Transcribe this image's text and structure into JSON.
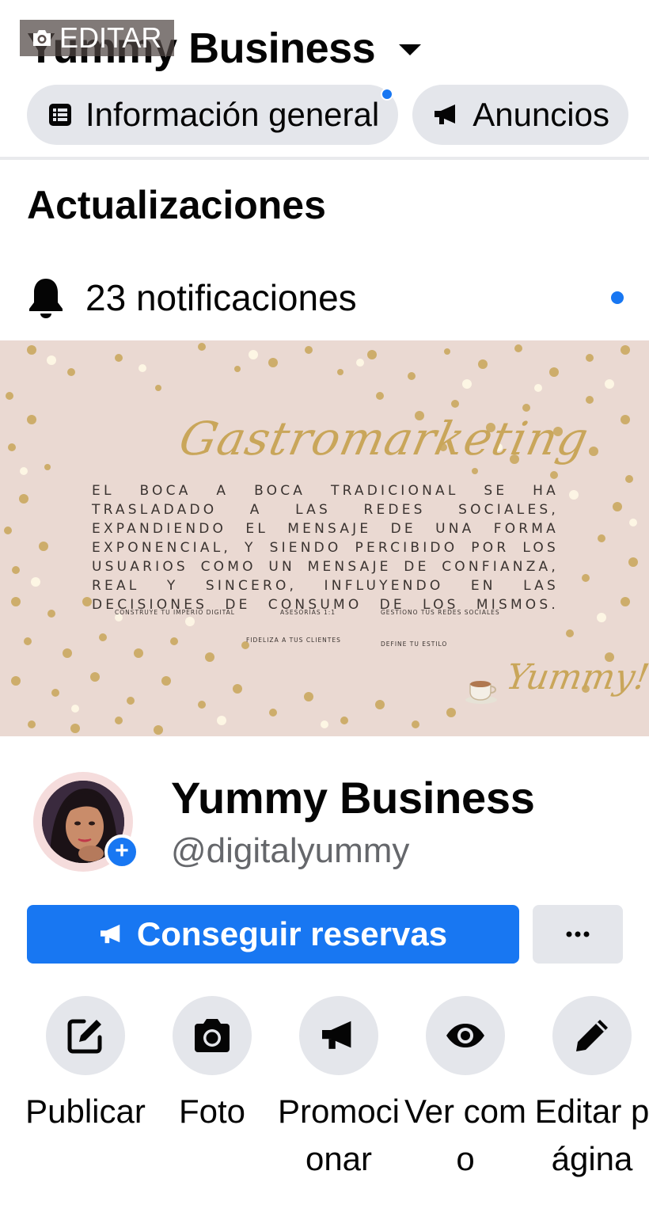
{
  "header": {
    "title": "Yummy Business",
    "tabs": [
      {
        "label": "Información general",
        "icon": "list-icon",
        "has_dot": true
      },
      {
        "label": "Anuncios",
        "icon": "megaphone-icon",
        "has_dot": false
      }
    ]
  },
  "updates": {
    "title": "Actualizaciones",
    "notifications_label": "23 notificaciones"
  },
  "cover": {
    "edit_label": "EDITAR",
    "script_title": "Gastromarketing",
    "body_text": "EL BOCA A BOCA TRADICIONAL SE HA TRASLADADO A LAS REDES SOCIALES, EXPANDIENDO EL MENSAJE DE UNA FORMA EXPONENCIAL, Y SIENDO PERCIBIDO POR LOS USUARIOS COMO UN MENSAJE DE CONFIANZA, REAL Y SINCERO, INFLUYENDO EN LAS DECISIONES DE CONSUMO DE LOS MISMOS.",
    "small_texts": [
      "CONSTRUYE TU IMPERIO DIGITAL",
      "ASESORÍAS 1:1",
      "GESTIONO TUS REDES SOCIALES",
      "FIDELIZA A TUS CLIENTES",
      "DEFINE TU ESTILO"
    ],
    "signature": "Yummy!"
  },
  "profile": {
    "name": "Yummy Business",
    "handle": "@digitalyummy"
  },
  "buttons": {
    "primary_label": "Conseguir reservas",
    "more_label": "···"
  },
  "actions": [
    {
      "label": "Publicar",
      "icon": "edit-square-icon"
    },
    {
      "label": "Foto",
      "icon": "camera-icon"
    },
    {
      "label": "Promocionar",
      "icon": "megaphone-icon"
    },
    {
      "label": "Ver como",
      "icon": "eye-icon"
    },
    {
      "label": "Editar página",
      "icon": "pencil-icon"
    }
  ],
  "colors": {
    "accent": "#1877f2",
    "button_gray": "#e4e6eb",
    "cover_bg": "#ead9d2",
    "gold": "#c9a65a"
  }
}
